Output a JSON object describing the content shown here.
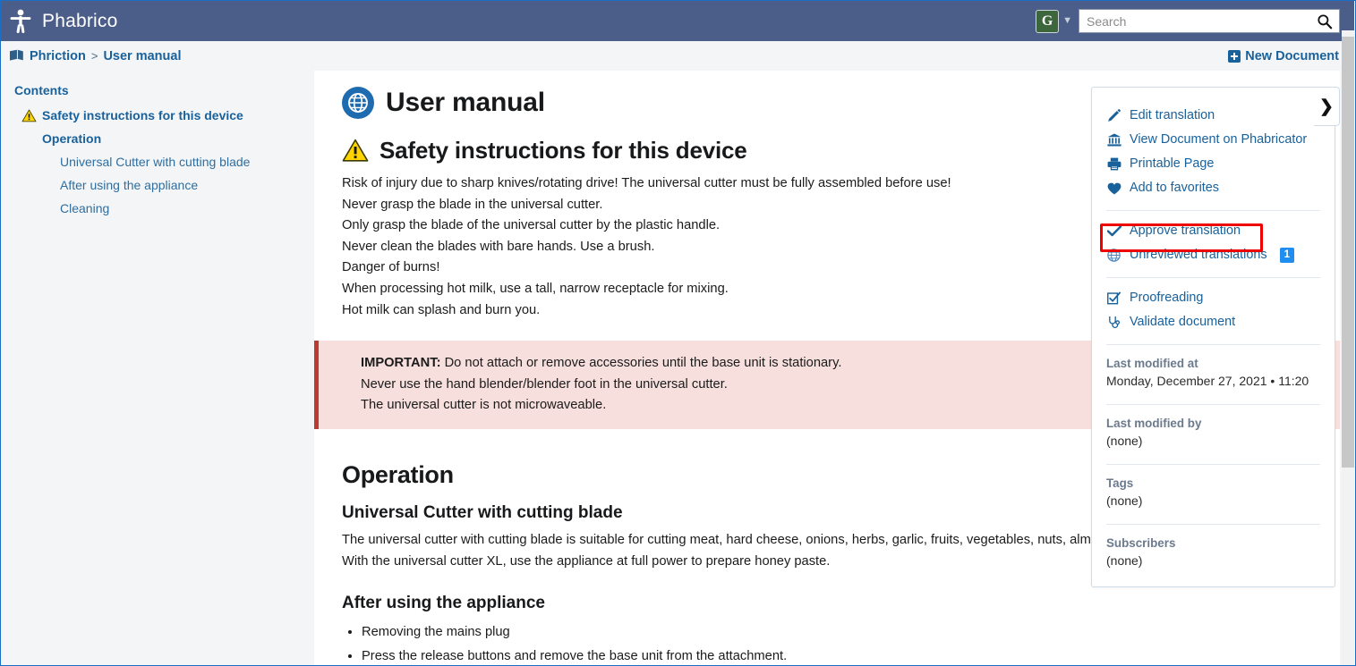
{
  "app": {
    "brand": "Phabrico",
    "logo_icon": "person-icon"
  },
  "search": {
    "placeholder": "Search",
    "value": "",
    "icon": "search-icon",
    "language_badge": "G",
    "caret_icon": "chevron-down-icon"
  },
  "breadcrumb": {
    "icon": "book-icon",
    "root": "Phriction",
    "separator": ">",
    "current": "User manual",
    "new_document": "New Document",
    "new_document_icon": "plus-square-icon"
  },
  "toc": {
    "title": "Contents",
    "items": [
      {
        "label": "Safety instructions for this device",
        "level": 1,
        "icon": "warning-triangle-icon",
        "bold": true
      },
      {
        "label": "Operation",
        "level": 1,
        "icon": "",
        "bold": true
      },
      {
        "label": "Universal Cutter with cutting blade",
        "level": 2,
        "icon": "",
        "bold": false
      },
      {
        "label": "After using the appliance",
        "level": 2,
        "icon": "",
        "bold": false
      },
      {
        "label": "Cleaning",
        "level": 2,
        "icon": "",
        "bold": false
      }
    ]
  },
  "document": {
    "title": "User manual",
    "title_icon": "globe-icon",
    "safety": {
      "heading": "Safety instructions for this device",
      "heading_icon": "warning-triangle-icon",
      "lines": [
        "Risk of injury due to sharp knives/rotating drive! The universal cutter must be fully assembled before use!",
        "Never grasp the blade in the universal cutter.",
        "Only grasp the blade of the universal cutter by the plastic handle.",
        "Never clean the blades with bare hands. Use a brush.",
        "Danger of burns!",
        "When processing hot milk, use a tall, narrow receptacle for mixing.",
        "Hot milk can splash and burn you."
      ]
    },
    "callout": {
      "prefix": "IMPORTANT:",
      "line1": " Do not attach or remove accessories until the base unit is stationary.",
      "line2": "Never use the hand blender/blender foot in the universal cutter.",
      "line3": "The universal cutter is not microwaveable."
    },
    "operation": {
      "heading": "Operation",
      "sub1": "Universal Cutter with cutting blade",
      "sub1_p1": "The universal cutter with cutting blade is suitable for cutting meat, hard cheese, onions, herbs, garlic, fruits, vegetables, nuts, alm",
      "sub1_p2": "With the universal cutter XL, use the appliance at full power to prepare honey paste.",
      "sub2": "After using the appliance",
      "bullets": [
        "Removing the mains plug",
        "Press the release buttons and remove the base unit from the attachment."
      ]
    }
  },
  "panel": {
    "toggle_icon": "chevron-right-icon",
    "actions": [
      {
        "label": "Edit translation",
        "icon": "pencil-icon"
      },
      {
        "label": "View Document on Phabricator",
        "icon": "bank-icon"
      },
      {
        "label": "Printable Page",
        "icon": "printer-icon"
      },
      {
        "label": "Add to favorites",
        "icon": "heart-icon"
      }
    ],
    "review_actions": [
      {
        "label": "Approve translation",
        "icon": "check-icon",
        "highlighted": true,
        "badge": ""
      },
      {
        "label": "Unreviewed translations",
        "icon": "globe-icon",
        "highlighted": false,
        "badge": "1"
      }
    ],
    "tools": [
      {
        "label": "Proofreading",
        "icon": "checkbox-checked-icon"
      },
      {
        "label": "Validate document",
        "icon": "stethoscope-icon"
      }
    ],
    "meta": [
      {
        "label": "Last modified at",
        "value": "Monday, December 27, 2021 • 11:20"
      },
      {
        "label": "Last modified by",
        "value": "(none)"
      },
      {
        "label": "Tags",
        "value": "(none)"
      },
      {
        "label": "Subscribers",
        "value": "(none)"
      }
    ]
  },
  "colors": {
    "topbar": "#4b5d89",
    "link": "#19619b",
    "accent_blue": "#1f6bb0",
    "badge_blue": "#1f8ef0",
    "highlight_red": "#ee0000",
    "callout_bg": "#f6dfdd",
    "callout_border": "#bb3b30",
    "lang_badge_green": "#3d663d"
  }
}
